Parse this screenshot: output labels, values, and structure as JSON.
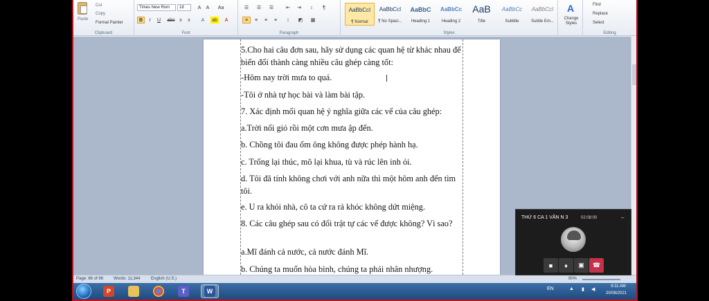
{
  "ribbon": {
    "clipboard": {
      "paste": "Paste",
      "cut": "Cut",
      "copy": "Copy",
      "format_painter": "Format Painter",
      "group": "Clipboard"
    },
    "font": {
      "name": "Times New Rom",
      "size": "18",
      "group": "Font"
    },
    "paragraph": {
      "group": "Paragraph"
    },
    "styles": {
      "group": "Styles",
      "items": [
        {
          "sample": "AaBbCcI",
          "name": "¶ Normal"
        },
        {
          "sample": "AaBbCcI",
          "name": "¶ No Spaci..."
        },
        {
          "sample": "AaBbC",
          "name": "Heading 1"
        },
        {
          "sample": "AaBbCc",
          "name": "Heading 2"
        },
        {
          "sample": "AaB",
          "name": "Title"
        },
        {
          "sample": "AaBbCc",
          "name": "Subtitle"
        },
        {
          "sample": "AaBbCcI",
          "name": "Subtle Em..."
        }
      ],
      "change_styles": "Change Styles"
    },
    "editing": {
      "find": "Find",
      "replace": "Replace",
      "select": "Select",
      "group": "Editing"
    }
  },
  "document": {
    "paragraphs": [
      "5.Cho hai câu đơn sau, hãy sử dụng các quan hệ từ khác nhau để biến đổi thành càng nhiều câu ghép càng tốt:",
      "-Hôm nay trời mưa to quá.",
      "-Tôi ở nhà tự học bài và làm bài tập.",
      "7. Xác định mối quan hệ ý nghĩa giữa các vế của câu ghép:",
      "a.Trời nổi gió rồi một cơn mưa ập đến.",
      "b. Chồng tôi đau ốm ông không được phép hành hạ.",
      "c. Trống lại thúc, mõ lại khua, tù và rúc lên inh ỏi.",
      "d. Tôi đã tính không chơi với anh nữa thì một hôm anh đến tìm tôi.",
      "e. U ra khỏi nhà, cô ta cứ ra rả khóc không dứt miệng.",
      "8. Các câu ghép sau có đổi trật tự các vế được không? Vì sao?",
      "a.Mĩ đánh cả nước, cả nước đánh Mĩ.",
      "b. Chúng ta muốn hòa bình, chúng ta phải nhân nhượng."
    ]
  },
  "statusbar": {
    "page": "Page: 66 of 66",
    "words": "Words: 11,344",
    "language": "English (U.S.)",
    "zoom": "90%"
  },
  "call": {
    "title": "THỨ 6 CA 1 VĂN N 3",
    "timer": "02:08:00"
  },
  "taskbar": {
    "lang": "EN",
    "time": "9:11 AM",
    "date": "20/08/2021"
  }
}
